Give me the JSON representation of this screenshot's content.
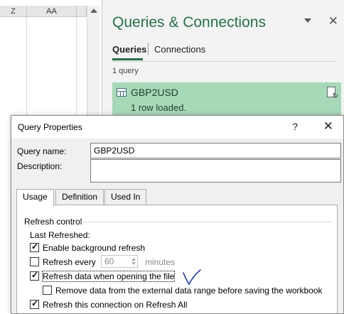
{
  "sheet": {
    "columns": [
      "Z",
      "AA"
    ]
  },
  "pane": {
    "title": "Queries & Connections",
    "close_glyph": "✕",
    "tabs": [
      "Queries",
      "Connections"
    ],
    "query_count": "1 query",
    "query": {
      "name": "GBP2USD",
      "status": "1 row loaded."
    }
  },
  "dialog": {
    "title": "Query Properties",
    "help_glyph": "?",
    "close_glyph": "✕",
    "query_name_label": "Query name:",
    "query_name_value": "GBP2USD",
    "description_label": "Description:",
    "description_value": "",
    "tabs": [
      "Usage",
      "Definition",
      "Used In"
    ],
    "refresh_control": {
      "group_title": "Refresh control",
      "last_refreshed": "Last Refreshed:",
      "enable_background": {
        "label": "Enable background refresh",
        "checked": true
      },
      "refresh_every": {
        "label": "Refresh every",
        "checked": false,
        "value": "60",
        "unit": "minutes"
      },
      "refresh_on_open": {
        "label": "Refresh data when opening the file",
        "checked": true
      },
      "remove_data": {
        "label": "Remove data from the external data range before saving the workbook",
        "checked": false
      },
      "refresh_all": {
        "label": "Refresh this connection on Refresh All",
        "checked": true
      }
    }
  }
}
